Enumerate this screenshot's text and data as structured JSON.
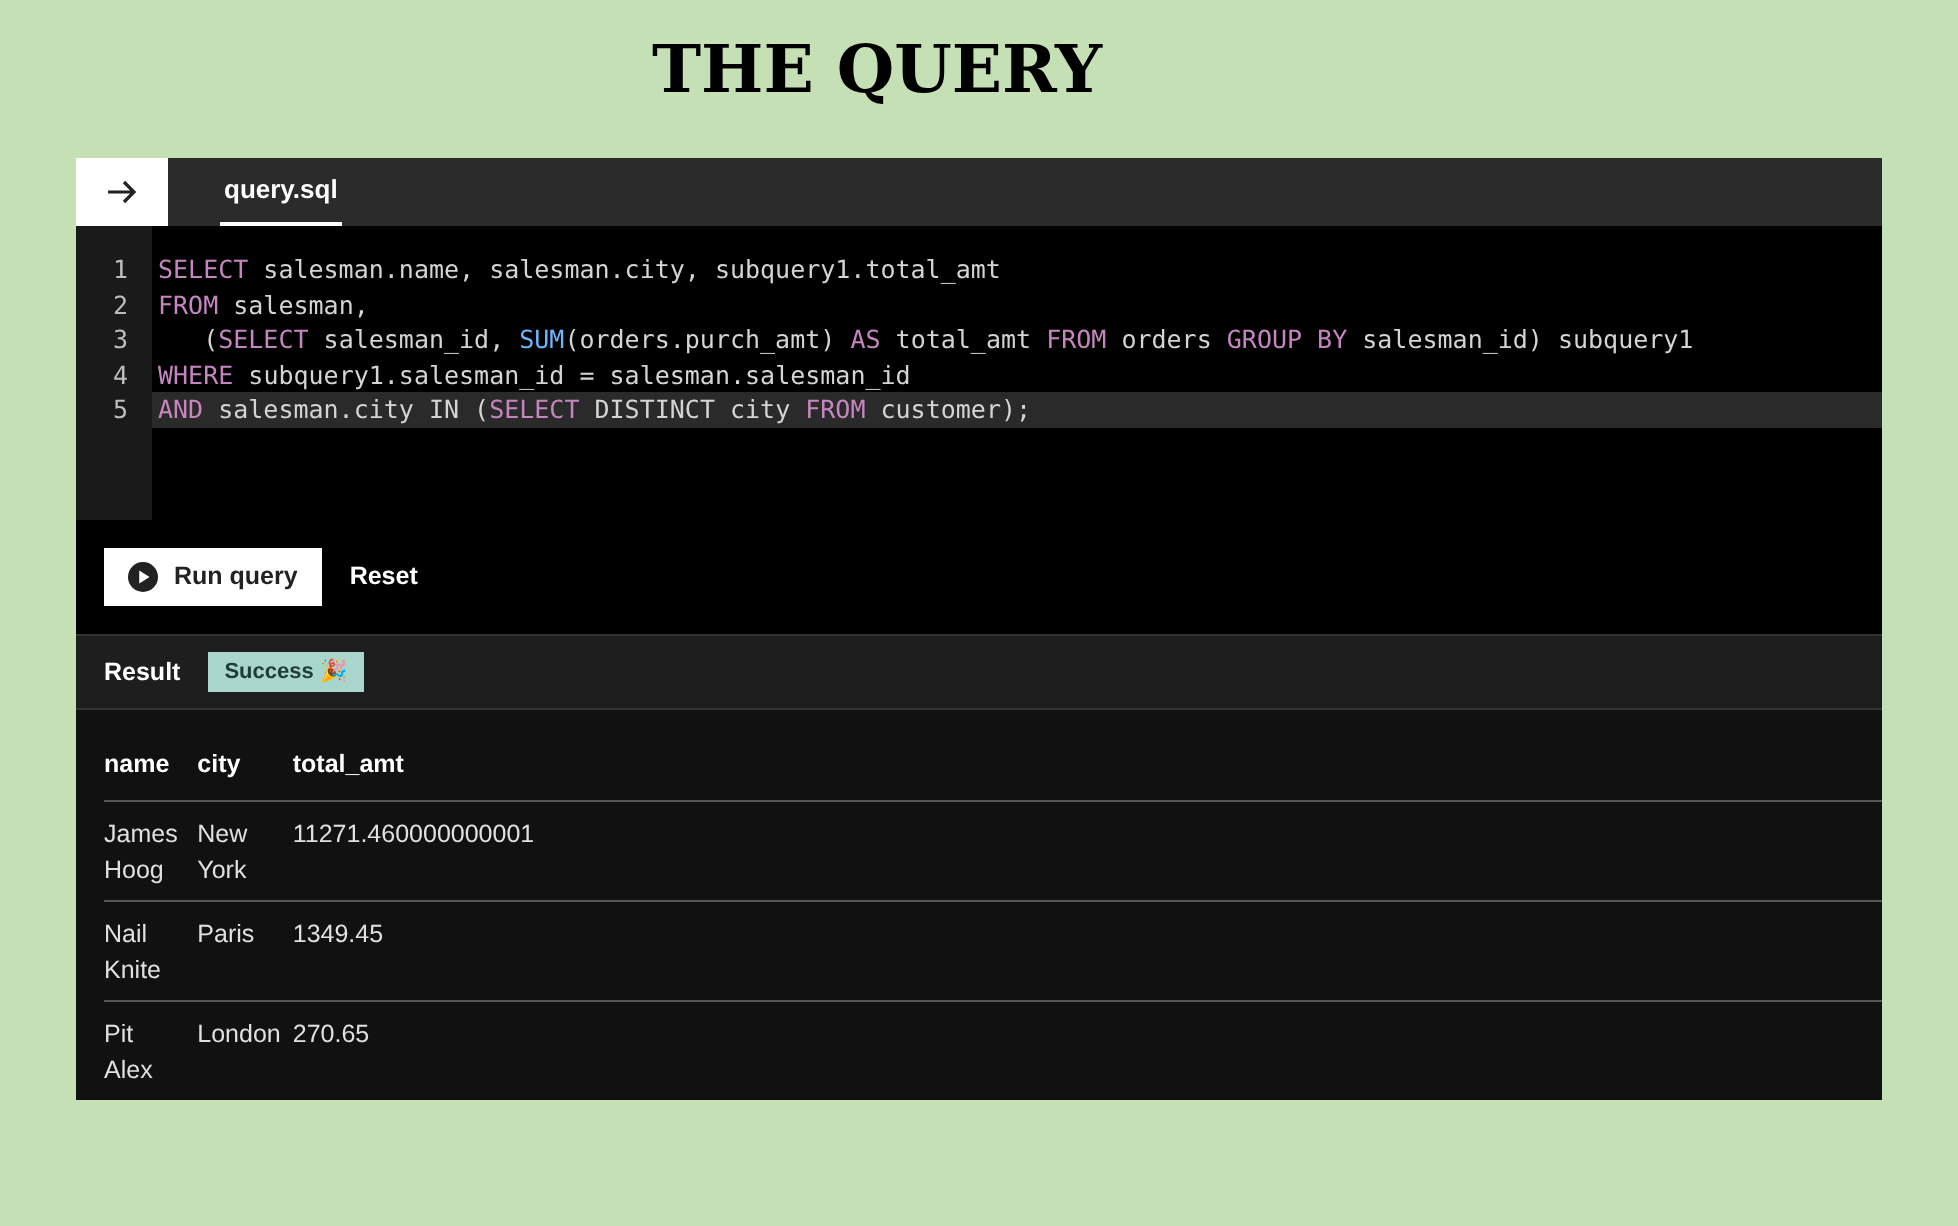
{
  "title": "THE QUERY",
  "tabs": [
    {
      "label": "query.sql",
      "selected": true
    }
  ],
  "editor": {
    "lines": [
      {
        "number": "1",
        "active": false,
        "tokens": [
          {
            "kind": "keyword",
            "text": "SELECT"
          },
          {
            "kind": "plain",
            "text": " salesman.name, salesman.city, subquery1.total_amt"
          }
        ]
      },
      {
        "number": "2",
        "active": false,
        "tokens": [
          {
            "kind": "keyword",
            "text": "FROM"
          },
          {
            "kind": "plain",
            "text": " salesman,"
          }
        ]
      },
      {
        "number": "3",
        "active": false,
        "tokens": [
          {
            "kind": "plain",
            "text": "   ("
          },
          {
            "kind": "keyword",
            "text": "SELECT"
          },
          {
            "kind": "plain",
            "text": " salesman_id, "
          },
          {
            "kind": "function",
            "text": "SUM"
          },
          {
            "kind": "plain",
            "text": "(orders.purch_amt) "
          },
          {
            "kind": "keyword",
            "text": "AS"
          },
          {
            "kind": "plain",
            "text": " total_amt "
          },
          {
            "kind": "keyword",
            "text": "FROM"
          },
          {
            "kind": "plain",
            "text": " orders "
          },
          {
            "kind": "keyword",
            "text": "GROUP BY"
          },
          {
            "kind": "plain",
            "text": " salesman_id) subquery1"
          }
        ]
      },
      {
        "number": "4",
        "active": false,
        "tokens": [
          {
            "kind": "keyword",
            "text": "WHERE"
          },
          {
            "kind": "plain",
            "text": " subquery1.salesman_id = salesman.salesman_id"
          }
        ]
      },
      {
        "number": "5",
        "active": true,
        "tokens": [
          {
            "kind": "keyword",
            "text": "AND"
          },
          {
            "kind": "plain",
            "text": " salesman.city IN ("
          },
          {
            "kind": "keyword",
            "text": "SELECT"
          },
          {
            "kind": "plain",
            "text": " DISTINCT city "
          },
          {
            "kind": "keyword",
            "text": "FROM"
          },
          {
            "kind": "plain",
            "text": " customer);"
          }
        ]
      }
    ]
  },
  "actions": [
    {
      "label": "Run query",
      "kind": "primary"
    },
    {
      "label": "Reset",
      "kind": "plain"
    }
  ],
  "result": {
    "label": "Result",
    "status": "Success 🎉",
    "columns": [
      "name",
      "city",
      "total_amt"
    ],
    "rows": [
      [
        "James Hoog",
        "New York",
        "11271.460000000001"
      ],
      [
        "Nail Knite",
        "Paris",
        "1349.45"
      ],
      [
        "Pit Alex",
        "London",
        "270.65"
      ]
    ]
  }
}
